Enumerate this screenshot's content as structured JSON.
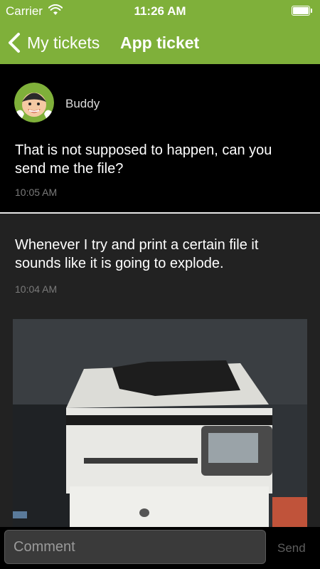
{
  "status_bar": {
    "carrier": "Carrier",
    "time": "11:26 AM"
  },
  "nav": {
    "back_label": "My tickets",
    "title": "App ticket",
    "accent_color": "#7fb03a"
  },
  "messages": [
    {
      "sender": "Buddy",
      "text": "That is not supposed to happen, can you send me the file?",
      "time": "10:05 AM"
    },
    {
      "text": "Whenever I try and print a certain file it sounds like it is going to explode.",
      "time": "10:04 AM",
      "attachment_icon": "printer-photo"
    }
  ],
  "composer": {
    "placeholder": "Comment",
    "send_label": "Send"
  }
}
